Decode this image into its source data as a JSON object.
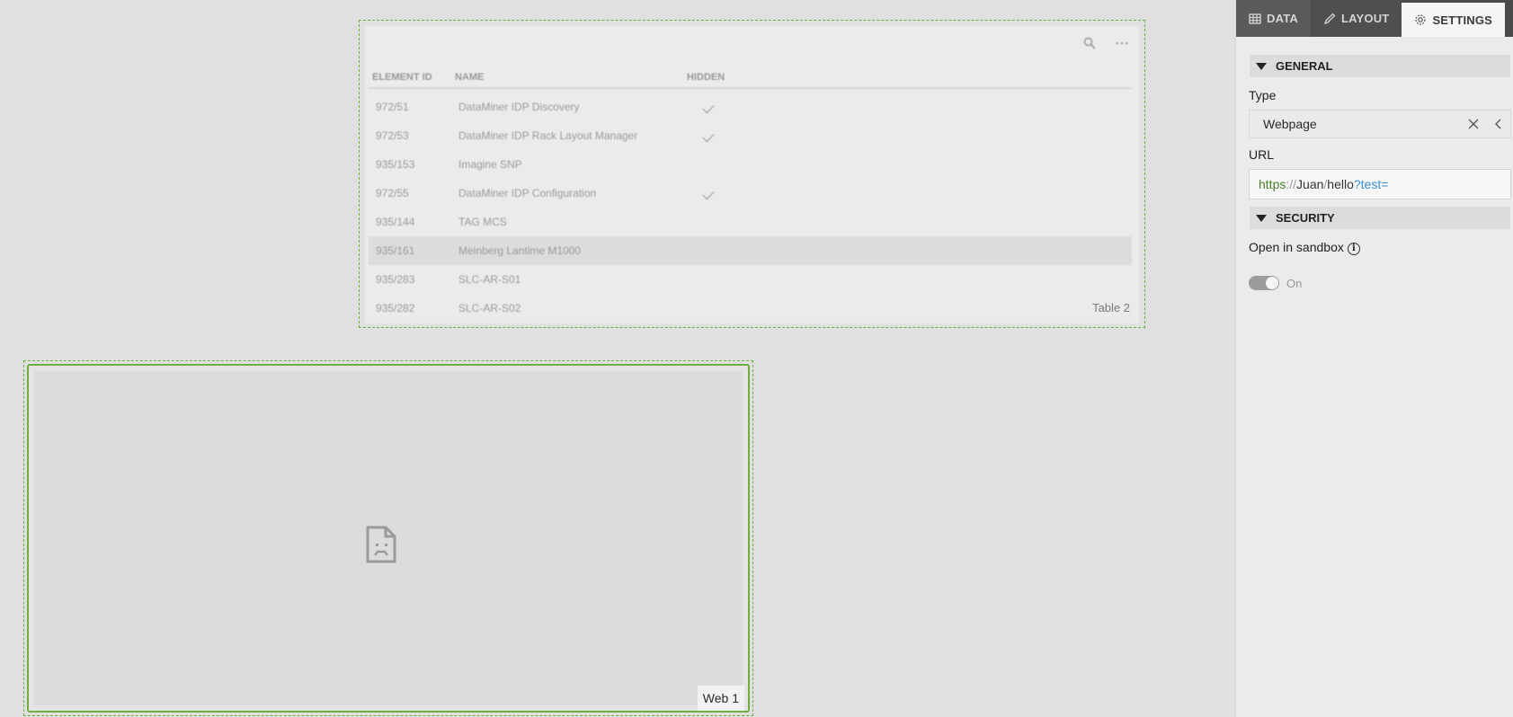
{
  "table": {
    "columns": [
      "ELEMENT ID",
      "NAME",
      "HIDDEN"
    ],
    "rows": [
      {
        "id": "972/51",
        "name": "DataMiner IDP Discovery",
        "hidden": true
      },
      {
        "id": "972/53",
        "name": "DataMiner IDP Rack Layout Manager",
        "hidden": true
      },
      {
        "id": "935/153",
        "name": "Imagine SNP",
        "hidden": false
      },
      {
        "id": "972/55",
        "name": "DataMiner IDP Configuration",
        "hidden": true
      },
      {
        "id": "935/144",
        "name": "TAG MCS",
        "hidden": false
      },
      {
        "id": "935/161",
        "name": "Meinberg Lantime M1000",
        "hidden": false,
        "selected": true
      },
      {
        "id": "935/283",
        "name": "SLC-AR-S01",
        "hidden": false
      },
      {
        "id": "935/282",
        "name": "SLC-AR-S02",
        "hidden": false
      }
    ],
    "label": "Table 2",
    "toolbar": {
      "search_icon": "search-icon",
      "more_icon": "ellipsis-icon"
    }
  },
  "web": {
    "label": "Web 1",
    "placeholder_icon": "broken-page-icon"
  },
  "panel": {
    "tabs": [
      {
        "label": "DATA",
        "icon": "grid-icon"
      },
      {
        "label": "LAYOUT",
        "icon": "pencil-icon"
      },
      {
        "label": "SETTINGS",
        "icon": "gear-icon",
        "active": true
      }
    ],
    "general": {
      "title": "GENERAL",
      "type_label": "Type",
      "type_value": "Webpage",
      "url_label": "URL",
      "url": {
        "scheme": "https",
        "sep1": "://",
        "host": "Juan",
        "sep2": "/",
        "path": "hello",
        "query_mark": "?",
        "query": "test="
      }
    },
    "security": {
      "title": "SECURITY",
      "sandbox_label": "Open in sandbox",
      "toggle_label": "On",
      "toggle_on": true
    }
  },
  "colors": {
    "accent_green": "#6fae3f",
    "tab_bar": "#4a4a4a",
    "url_query": "#3b8fd0"
  }
}
